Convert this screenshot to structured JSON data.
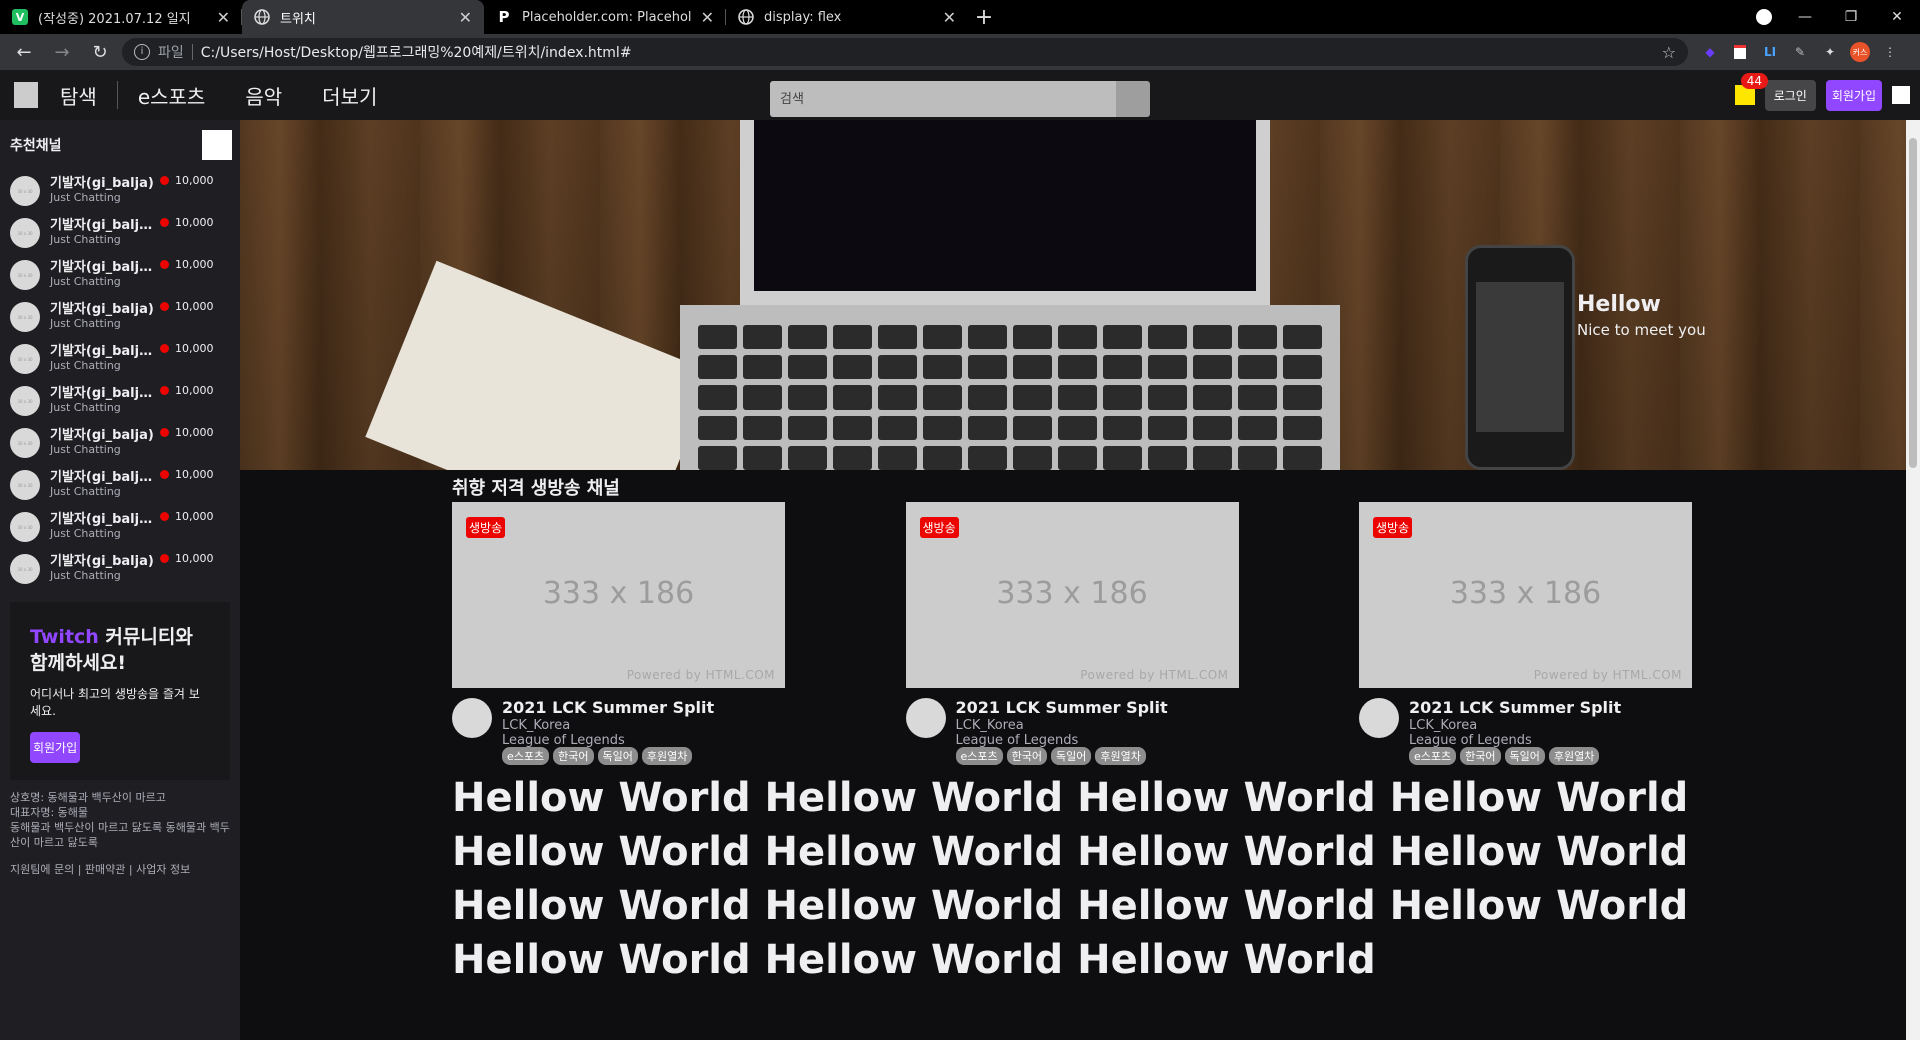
{
  "browser": {
    "tabs": [
      {
        "title": "(작성중) 2021.07.12 일지",
        "favicon": "V",
        "favicon_color": "#1fbf5f",
        "active": false
      },
      {
        "title": "트위치",
        "favicon": "globe",
        "active": true
      },
      {
        "title": "Placeholder.com: Placeholder.co",
        "favicon": "P",
        "active": false
      },
      {
        "title": "display: flex",
        "favicon": "globe",
        "active": false
      }
    ],
    "new_tab": "+",
    "address": {
      "label": "파일",
      "url": "C:/Users/Host/Desktop/웹프로그래밍%20예제/트위치/index.html#"
    },
    "profile_badge": "커스"
  },
  "header": {
    "nav": [
      "탐색",
      "e스포츠",
      "음악",
      "더보기"
    ],
    "search_placeholder": "검색",
    "notifications": "44",
    "login": "로그인",
    "signup": "회원가입"
  },
  "sidebar": {
    "title": "추천채널",
    "channels": [
      {
        "name": "기발자(gi_balja)",
        "category": "Just Chatting",
        "viewers": "10,000"
      },
      {
        "name": "기발자(gi_balja...",
        "category": "Just Chatting",
        "viewers": "10,000"
      },
      {
        "name": "기발자(gi_balja...",
        "category": "Just Chatting",
        "viewers": "10,000"
      },
      {
        "name": "기발자(gi_balja)",
        "category": "Just Chatting",
        "viewers": "10,000"
      },
      {
        "name": "기발자(gi_balja...",
        "category": "Just Chatting",
        "viewers": "10,000"
      },
      {
        "name": "기발자(gi_balja...",
        "category": "Just Chatting",
        "viewers": "10,000"
      },
      {
        "name": "기발자(gi_balja)",
        "category": "Just Chatting",
        "viewers": "10,000"
      },
      {
        "name": "기발자(gi_balja...",
        "category": "Just Chatting",
        "viewers": "10,000"
      },
      {
        "name": "기발자(gi_balja...",
        "category": "Just Chatting",
        "viewers": "10,000"
      },
      {
        "name": "기발자(gi_balja)",
        "category": "Just Chatting",
        "viewers": "10,000"
      }
    ],
    "avatar_text": "30 x 30",
    "promo": {
      "brand": "Twitch",
      "heading_rest": " 커뮤니티와 함께하세요!",
      "text": "어디서나 최고의 생방송을 즐겨 보세요.",
      "button": "회원가입"
    },
    "footer": {
      "line1": "상호명: 동해물과 백두산이 마르고",
      "line2": "대표자명: 동해물",
      "line3": "동해물과 백두산이 마르고 닳도록 동해물과 백두산이 마르고 닳도록",
      "links": "지원팀에 문의 | 판매약관 | 사업자 정보"
    }
  },
  "hero": {
    "title": "Hellow",
    "subtitle": "Nice to meet you"
  },
  "section": {
    "title": "취향 저격 생방송 채널",
    "cards": [
      {
        "live": "생방송",
        "thumb_size": "333 x 186",
        "powered": "Powered by HTML.COM",
        "title": "2021 LCK Summer Split",
        "channel": "LCK_Korea",
        "game": "League of Legends",
        "tags": [
          "e스포츠",
          "한국어",
          "독일어",
          "후원열차"
        ]
      },
      {
        "live": "생방송",
        "thumb_size": "333 x 186",
        "powered": "Powered by HTML.COM",
        "title": "2021 LCK Summer Split",
        "channel": "LCK_Korea",
        "game": "League of Legends",
        "tags": [
          "e스포츠",
          "한국어",
          "독일어",
          "후원열차"
        ]
      },
      {
        "live": "생방송",
        "thumb_size": "333 x 186",
        "powered": "Powered by HTML.COM",
        "title": "2021 LCK Summer Split",
        "channel": "LCK_Korea",
        "game": "League of Legends",
        "tags": [
          "e스포츠",
          "한국어",
          "독일어",
          "후원열차"
        ]
      }
    ],
    "big_text": "Hellow World Hellow World Hellow World Hellow World Hellow World Hellow World Hellow World Hellow World Hellow World Hellow World Hellow World Hellow World Hellow World Hellow World Hellow World"
  },
  "colors": {
    "brand": "#9147ff",
    "live": "#eb0400",
    "bg": "#0e0e10",
    "sidebar": "#1f1f23"
  }
}
